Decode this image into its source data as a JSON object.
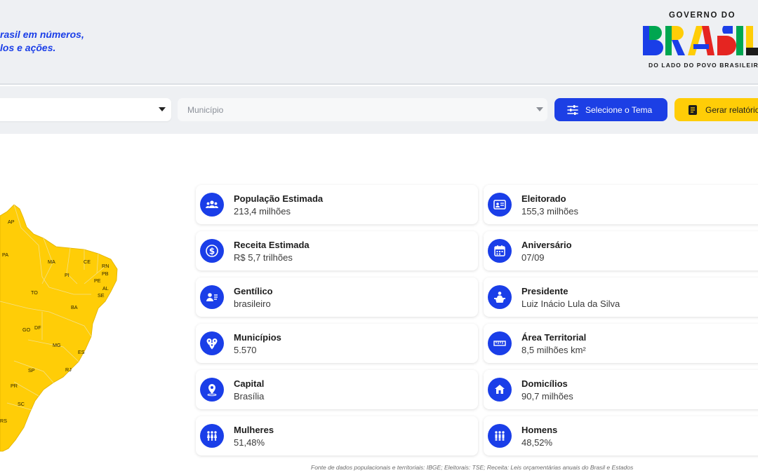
{
  "header": {
    "tagline_line1": "rasil em números,",
    "tagline_line2": "los e ações.",
    "logo": {
      "top_text": "GOVERNO DO",
      "brand_text": "BRASIL",
      "bottom_text": "DO LADO DO POVO BRASILEIRO",
      "colors": [
        "#1a3ee8",
        "#00a650",
        "#ffcd07",
        "#e52521",
        "#1b1b1b"
      ]
    }
  },
  "filters": {
    "state_select": {
      "value": "",
      "icon": "caret-down-icon"
    },
    "municipio_select": {
      "placeholder": "Município",
      "icon": "caret-down-icon"
    },
    "theme_button": {
      "label": "Selecione o Tema",
      "icon": "sliders-icon"
    },
    "report_button": {
      "label": "Gerar relatório",
      "icon": "document-icon"
    }
  },
  "map": {
    "fill_color": "#ffcd07",
    "states": [
      "AP",
      "PA",
      "MA",
      "CE",
      "RN",
      "PB",
      "PI",
      "PE",
      "AL",
      "SE",
      "TO",
      "BA",
      "GO",
      "DF",
      "MG",
      "ES",
      "SP",
      "RJ",
      "PR",
      "SC",
      "RS"
    ]
  },
  "stats": [
    {
      "label": "População Estimada",
      "value": "213,4 milhões",
      "icon": "people-group-icon"
    },
    {
      "label": "Eleitorado",
      "value": "155,3 milhões",
      "icon": "voter-id-card-icon"
    },
    {
      "label": "Receita Estimada",
      "value": "R$ 5,7 trilhões",
      "icon": "dollar-coin-icon"
    },
    {
      "label": "Aniversário",
      "value": "07/09",
      "icon": "calendar-icon"
    },
    {
      "label": "Gentílico",
      "value": "brasileiro",
      "icon": "person-id-icon"
    },
    {
      "label": "Presidente",
      "value": "Luiz Inácio Lula da Silva",
      "icon": "podium-icon"
    },
    {
      "label": "Municípios",
      "value": "5.570",
      "icon": "map-pins-icon"
    },
    {
      "label": "Área Territorial",
      "value": "8,5 milhões km²",
      "icon": "ruler-icon"
    },
    {
      "label": "Capital",
      "value": "Brasília",
      "icon": "location-pin-icon"
    },
    {
      "label": "Domicílios",
      "value": "90,7 milhões",
      "icon": "houses-icon"
    },
    {
      "label": "Mulheres",
      "value": "51,48%",
      "icon": "women-icon"
    },
    {
      "label": "Homens",
      "value": "48,52%",
      "icon": "men-icon"
    }
  ],
  "footer": {
    "source": "Fonte de dados populacionais e territoriais: IBGE; Eleitorais: TSE; Receita: Leis orçamentárias anuais do Brasil e Estados"
  }
}
